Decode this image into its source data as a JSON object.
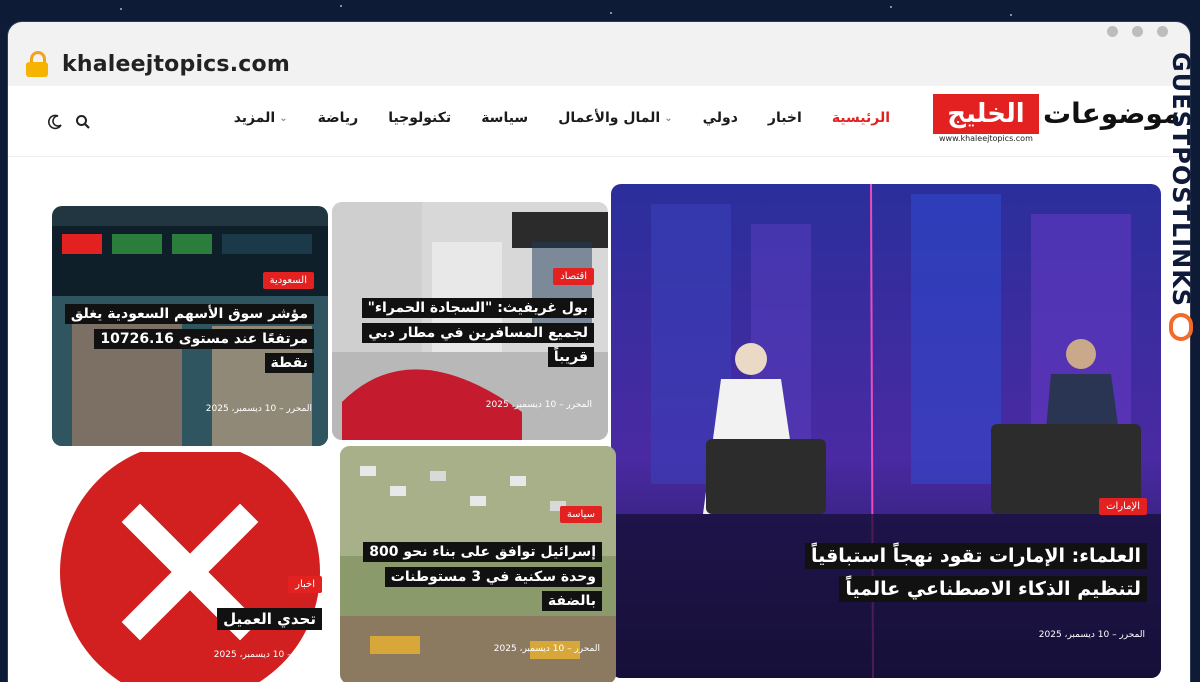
{
  "browser": {
    "url": "khaleejtopics.com"
  },
  "site": {
    "logo_red": "الخليج",
    "logo_dark": "موضوعات",
    "logo_sub": "www.khaleejtopics.com"
  },
  "nav": {
    "items": [
      {
        "label": "الرئيسية"
      },
      {
        "label": "اخبار"
      },
      {
        "label": "دولي"
      },
      {
        "label": "المال والأعمال"
      },
      {
        "label": "سياسة"
      },
      {
        "label": "تكنولوجيا"
      },
      {
        "label": "رياضة"
      },
      {
        "label": "المزيد"
      }
    ]
  },
  "icons": [
    "search-icon",
    "moon-icon",
    "lock-icon",
    "chevron-down-icon"
  ],
  "cards": {
    "main": {
      "tag": "الإمارات",
      "title": "العلماء: الإمارات تقود نهجاً استباقياً لتنظيم الذكاء الاصطناعي عالمياً",
      "meta": "المحرر  –  10 ديسمبر، 2025"
    },
    "airport": {
      "tag": "اقتصاد",
      "title": "بول غريفيث: \"السجادة الحمراء\" لجميع المسافرين في مطار دبي قريباً",
      "meta": "المحرر  –  10 ديسمبر، 2025"
    },
    "market": {
      "tag": "السعودية",
      "title": "مؤشر سوق الأسهم السعودية يغلق مرتفعًا عند مستوى 10726.16 نقطة",
      "meta": "المحرر  –  10 ديسمبر، 2025"
    },
    "israel": {
      "tag": "سياسة",
      "title": "إسرائيل توافق على بناء نحو 800 وحدة سكنية في 3 مستوطنات بالضفة",
      "meta": "المحرر  –  10 ديسمبر، 2025"
    },
    "client": {
      "tag": "اخبار",
      "title": "تحدي العميل",
      "meta": "المحرر  –  10 ديسمبر، 2025"
    }
  },
  "watermark": {
    "text": "GUESTPOSTLINKS"
  },
  "colors": {
    "accent": "#e32121",
    "background": "#0d1b36"
  }
}
